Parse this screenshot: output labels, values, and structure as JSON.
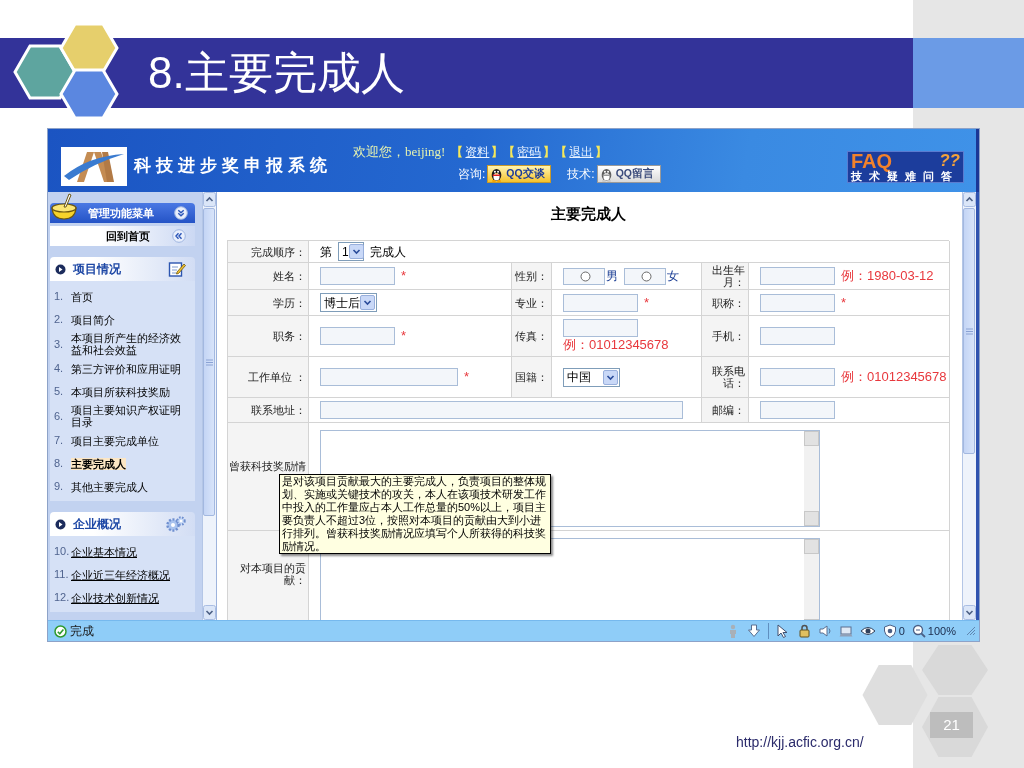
{
  "slide": {
    "title": "8.主要完成人"
  },
  "app_header": {
    "system_title": "科技进步奖申报系统",
    "welcome": "欢迎您，beijing!",
    "links": [
      {
        "open": "【",
        "label": "资料",
        "close": "】"
      },
      {
        "open": "【",
        "label": "密码",
        "close": "】"
      },
      {
        "open": "【",
        "label": "退出",
        "close": "】"
      }
    ],
    "contacts": [
      {
        "label": "咨询:",
        "button": "QQ交谈",
        "kind": "online"
      },
      {
        "label": "技术:",
        "button": "QQ留言",
        "kind": "offline"
      }
    ],
    "faq_logo": {
      "title": "FAQ",
      "mark": "??",
      "subtitle": "技术疑难问答"
    }
  },
  "sidebar": {
    "menu_title": "管理功能菜单",
    "home_link": "回到首页",
    "sections": [
      {
        "title": "项目情况",
        "kind": "project",
        "items": [
          {
            "number": "1.",
            "label": "首页",
            "selected": false
          },
          {
            "number": "2.",
            "label": "项目简介",
            "selected": false
          },
          {
            "number": "3.",
            "label": "本项目所产生的经济效益和社会效益",
            "selected": false
          },
          {
            "number": "4.",
            "label": "第三方评价和应用证明",
            "selected": false
          },
          {
            "number": "5.",
            "label": "本项目所获科技奖励",
            "selected": false
          },
          {
            "number": "6.",
            "label": "项目主要知识产权证明目录",
            "selected": false
          },
          {
            "number": "7.",
            "label": "项目主要完成单位",
            "selected": false
          },
          {
            "number": "8.",
            "label": "主要完成人",
            "selected": true
          },
          {
            "number": "9.",
            "label": "其他主要完成人",
            "selected": false
          }
        ]
      },
      {
        "title": "企业概况",
        "kind": "company",
        "items": [
          {
            "number": "10.",
            "label": "企业基本情况",
            "selected": false
          },
          {
            "number": "11.",
            "label": "企业近三年经济概况",
            "selected": false
          },
          {
            "number": "12.",
            "label": "企业技术创新情况",
            "selected": false
          }
        ]
      }
    ]
  },
  "form": {
    "title": "主要完成人",
    "rows": [
      {
        "cells": [
          {
            "label": "完成顺序：",
            "kind": "order",
            "prefix": "第",
            "value": "1",
            "suffix": "完成人"
          }
        ]
      },
      {
        "cells": [
          {
            "label": "姓名：",
            "kind": "text",
            "required": "*"
          },
          {
            "label": "性别：",
            "kind": "radio",
            "options": [
              {
                "label": "男",
                "selected": false
              },
              {
                "label": "女",
                "selected": false
              }
            ]
          },
          {
            "label": "出生年月：",
            "kind": "text",
            "hint": "例：1980-03-12"
          }
        ]
      },
      {
        "cells": [
          {
            "label": "学历：",
            "kind": "select",
            "value": "博士后"
          },
          {
            "label": "专业：",
            "kind": "text",
            "required": "*"
          },
          {
            "label": "职称：",
            "kind": "text",
            "required": "*"
          }
        ]
      },
      {
        "cells": [
          {
            "label": "职务：",
            "kind": "text",
            "required": "*"
          },
          {
            "label": "传真：",
            "kind": "text",
            "hint": "例：01012345678"
          },
          {
            "label": "手机：",
            "kind": "text"
          }
        ]
      },
      {
        "cells": [
          {
            "label": "工作单位 ：",
            "kind": "text_wide",
            "required": "*"
          },
          {
            "label": "国籍：",
            "kind": "select",
            "value": "中国"
          },
          {
            "label": "联系电话：",
            "kind": "text",
            "hint": "例：01012345678"
          }
        ]
      },
      {
        "cells": [
          {
            "label": "联系地址：",
            "kind": "text_full"
          },
          "",
          {
            "label": "邮编：",
            "kind": "text"
          }
        ]
      },
      {
        "cells": [
          {
            "label": "曾获科技奖励情",
            "kind": "textarea"
          }
        ]
      },
      {
        "cells": [
          {
            "label": "对本项目的贡献：",
            "kind": "textarea"
          }
        ]
      }
    ]
  },
  "tooltip": "是对该项目贡献最大的主要完成人，负责项目的整体规划、实施或关键技术的攻关，本人在该项技术研发工作中投入的工作量应占本人工作总量的50%以上，项目主要负责人不超过3位，按照对本项目的贡献由大到小进行排列。曾获科技奖励情况应填写个人所获得的科技奖励情况。",
  "status_bar": {
    "status": "完成",
    "blocked_count": "0",
    "zoom": "100%"
  },
  "footer": {
    "url": "http://kjj.acfic.org.cn/",
    "page_number": "21"
  }
}
